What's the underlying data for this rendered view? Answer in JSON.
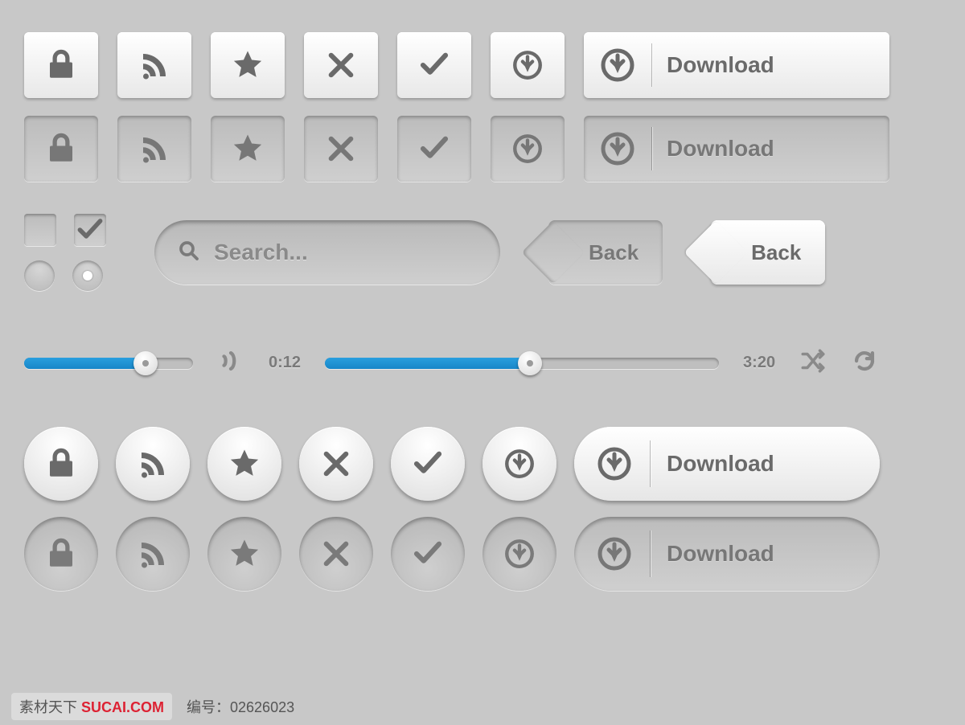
{
  "buttons": {
    "download_label": "Download",
    "back_label": "Back"
  },
  "search": {
    "placeholder": "Search..."
  },
  "player": {
    "volume_percent": 72,
    "elapsed": "0:12",
    "total": "3:20",
    "progress_percent": 52
  },
  "footer": {
    "brand": "素材天下",
    "brand_suffix": "SUCAI.COM",
    "meta_label": "编号：",
    "meta_value": "02626023"
  },
  "colors": {
    "accent": "#1f8ecf"
  }
}
